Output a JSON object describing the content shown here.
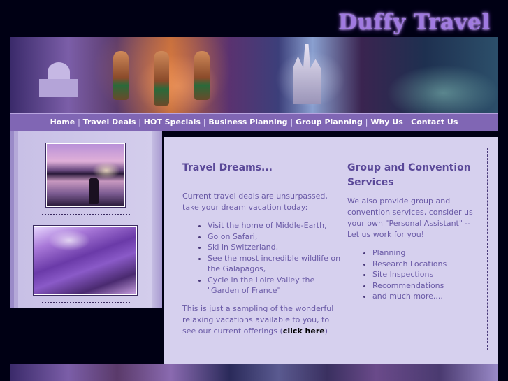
{
  "site": {
    "logo": "Duffy Travel"
  },
  "nav": {
    "items": [
      "Home",
      "Travel Deals",
      "HOT Specials",
      "Business Planning",
      "Group Planning",
      "Why Us",
      "Contact Us"
    ],
    "separator": "|"
  },
  "left": {
    "heading": "Travel Dreams...",
    "intro": "Current travel deals are unsurpassed, take your dream vacation today:",
    "items": [
      "Visit the home of Middle-Earth,",
      "Go on Safari,",
      "Ski in Switzerland,",
      "See the most incredible wildlife on the Galapagos,",
      "Cycle in the Loire Valley the \"Garden of France\""
    ],
    "outro_prefix": "This is just a sampling of the wonderful relaxing vacations available to you, to see our current offerings (",
    "link_label": "click here",
    "outro_suffix": ")"
  },
  "right": {
    "heading": "Group and Convention Services",
    "intro": "We also provide group and convention services, consider us your own \"Personal Assistant\" -- Let us work for you!",
    "items": [
      "Planning",
      "Research Locations",
      "Site Inspections",
      "Recommendations",
      "and much more...."
    ]
  },
  "colors": {
    "page_bg": "#000014",
    "nav_bg": "#8066b4",
    "content_bg": "#d6d0ee",
    "heading": "#5a4898",
    "text": "#6a5aa6"
  }
}
